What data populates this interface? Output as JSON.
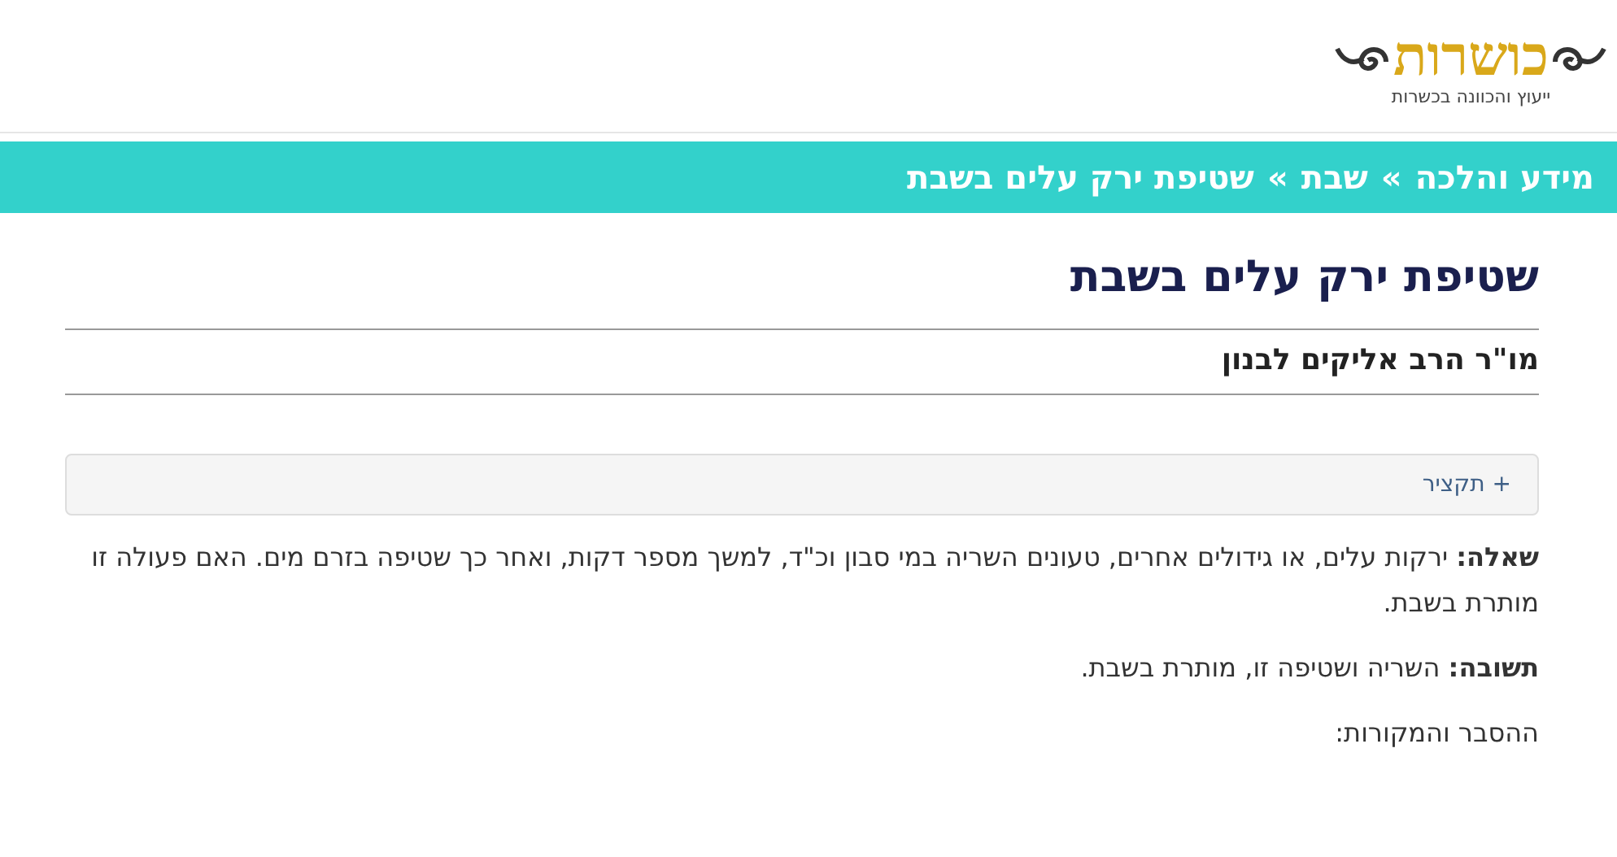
{
  "header": {
    "logo": {
      "name": "כושרות",
      "tagline": "ייעוץ והכוונה בכשרות"
    }
  },
  "breadcrumb": {
    "separator": "»",
    "items": [
      {
        "label": "מידע והלכה"
      },
      {
        "label": "שבת"
      },
      {
        "label": "שטיפת ירק עלים בשבת"
      }
    ]
  },
  "article": {
    "title": "שטיפת ירק עלים בשבת",
    "author": "מו\"ר הרב אליקים לבנון",
    "summary": {
      "icon": "+",
      "label": "תקציר",
      "expanded": false
    },
    "paragraphs": [
      "**שאלה:** ירקות עלים, או גידולים אחרים, טעונים השריה במי סבון וכ\"ד, למשך מספר דקות, ואחר כך שטיפה בזרם מים. האם פעולה זו מותרת בשבת.",
      "**תשובה:** השריה ושטיפה זו, מותרת בשבת.",
      "ההסבר והמקורות:"
    ]
  }
}
